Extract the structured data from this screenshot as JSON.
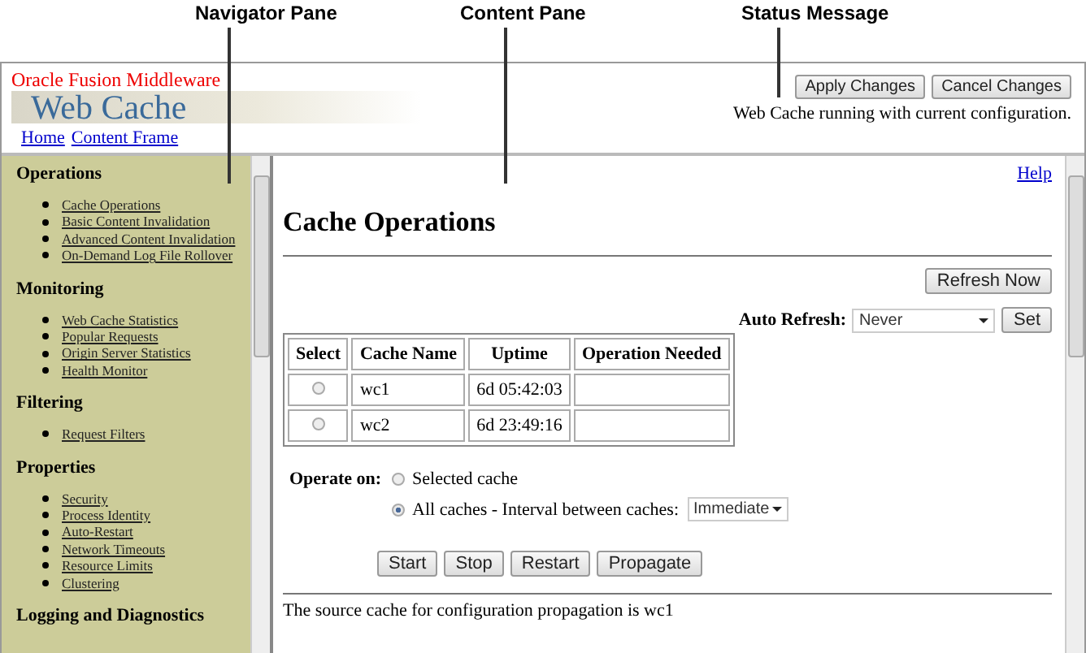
{
  "callouts": [
    {
      "label": "Navigator Pane"
    },
    {
      "label": "Content Pane"
    },
    {
      "label": "Status Message"
    }
  ],
  "header": {
    "product": "Oracle Fusion Middleware",
    "logo": "Web Cache",
    "links": [
      "Home",
      "Content Frame"
    ],
    "buttons": [
      "Apply Changes",
      "Cancel Changes"
    ],
    "status": "Web Cache running with current configuration."
  },
  "navigator": {
    "sections": [
      {
        "title": "Operations",
        "items": [
          "Cache Operations",
          "Basic Content Invalidation",
          "Advanced Content Invalidation",
          "On-Demand Log File Rollover"
        ]
      },
      {
        "title": "Monitoring",
        "items": [
          "Web Cache Statistics",
          "Popular Requests",
          "Origin Server Statistics",
          "Health Monitor"
        ]
      },
      {
        "title": "Filtering",
        "items": [
          "Request Filters"
        ]
      },
      {
        "title": "Properties",
        "items": [
          "Security",
          "Process Identity",
          "Auto-Restart",
          "Network Timeouts",
          "Resource Limits",
          "Clustering"
        ]
      },
      {
        "title": "Logging and Diagnostics"
      }
    ]
  },
  "content": {
    "help": "Help",
    "title": "Cache Operations",
    "refresh_button": "Refresh Now",
    "auto_refresh": {
      "label": "Auto Refresh:",
      "value": "Never",
      "button": "Set"
    },
    "table": {
      "columns": [
        "Select",
        "Cache Name",
        "Uptime",
        "Operation Needed"
      ],
      "rows": [
        {
          "selected": false,
          "cache_name": "wc1",
          "uptime": "6d 05:42:03"
        },
        {
          "selected": false,
          "cache_name": "wc2",
          "uptime": "6d 23:49:16"
        }
      ]
    },
    "operate_on": {
      "label": "Operate on:",
      "options": [
        {
          "label": "Selected cache",
          "selected": false
        },
        {
          "label": "All caches - Interval between caches:",
          "selected": true,
          "dropdown": "Immediate"
        }
      ]
    },
    "buttons": [
      "Start",
      "Stop",
      "Restart",
      "Propagate"
    ],
    "footer": "The source cache for configuration propagation is wc1"
  }
}
